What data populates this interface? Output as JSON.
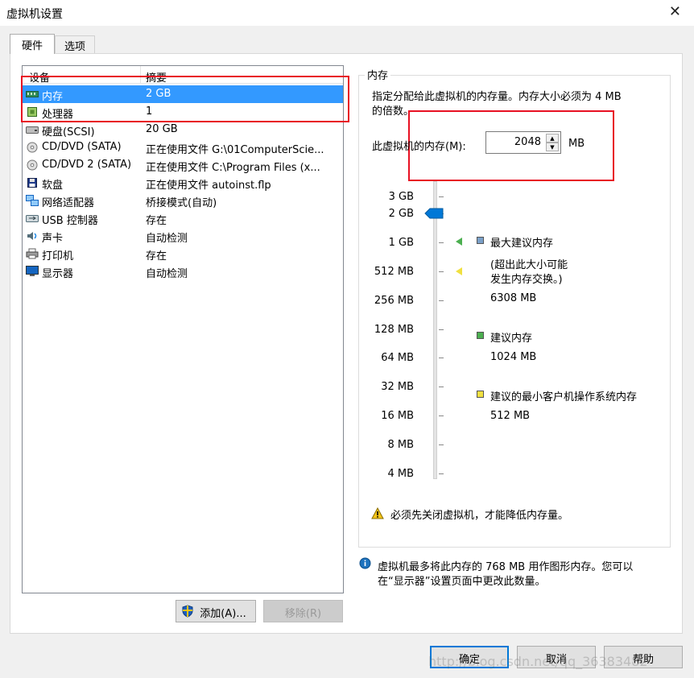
{
  "window": {
    "title": "虚拟机设置",
    "close_glyph": "✕"
  },
  "tabs": [
    {
      "label": "硬件"
    },
    {
      "label": "选项"
    }
  ],
  "device_list": {
    "headers": {
      "device": "设备",
      "summary": "摘要"
    },
    "rows": [
      {
        "name": "内存",
        "summary": "2 GB",
        "icon": "memory-icon",
        "selected": true
      },
      {
        "name": "处理器",
        "summary": "1",
        "icon": "cpu-icon"
      },
      {
        "name": "硬盘(SCSI)",
        "summary": "20 GB",
        "icon": "harddisk-icon"
      },
      {
        "name": "CD/DVD (SATA)",
        "summary": "正在使用文件 G:\\01ComputerScie...",
        "icon": "cd-icon"
      },
      {
        "name": "CD/DVD 2 (SATA)",
        "summary": "正在使用文件 C:\\Program Files (x...",
        "icon": "cd-icon"
      },
      {
        "name": "软盘",
        "summary": "正在使用文件 autoinst.flp",
        "icon": "floppy-icon"
      },
      {
        "name": "网络适配器",
        "summary": "桥接模式(自动)",
        "icon": "network-icon"
      },
      {
        "name": "USB 控制器",
        "summary": "存在",
        "icon": "usb-icon"
      },
      {
        "name": "声卡",
        "summary": "自动检测",
        "icon": "sound-icon"
      },
      {
        "name": "打印机",
        "summary": "存在",
        "icon": "printer-icon"
      },
      {
        "name": "显示器",
        "summary": "自动检测",
        "icon": "display-icon"
      }
    ]
  },
  "buttons": {
    "add": "添加(A)...",
    "remove": "移除(R)",
    "ok": "确定",
    "cancel": "取消",
    "help": "帮助"
  },
  "memory_panel": {
    "group_label": "内存",
    "description_line1": "指定分配给此虚拟机的内存量。内存大小必须为 4 MB",
    "description_line2": "的倍数。",
    "field_label": "此虚拟机的内存(M):",
    "value": "2048",
    "unit": "MB",
    "slider_level_mb": 2048,
    "scale_labels": [
      "3 GB",
      "2 GB",
      "1 GB",
      "512 MB",
      "256 MB",
      "128 MB",
      "64 MB",
      "32 MB",
      "16 MB",
      "8 MB",
      "4 MB"
    ],
    "legend": {
      "max_title": "最大建议内存",
      "max_note_line1": "(超出此大小可能",
      "max_note_line2": "发生内存交换。)",
      "max_value": "6308 MB",
      "rec_title": "建议内存",
      "rec_value": "1024 MB",
      "min_title": "建议的最小客户机操作系统内存",
      "min_value": "512 MB"
    },
    "warning": "必须先关闭虚拟机，才能降低内存量。",
    "info_line1": "虚拟机最多将此内存的 768 MB 用作图形内存。您可以",
    "info_line2": "在“显示器”设置页面中更改此数量。"
  },
  "colors": {
    "selection": "#3399ff",
    "annotation_red": "#e81123",
    "max_marker": "#7aa0c8",
    "rec_marker": "#4caf50",
    "min_marker": "#f0e040"
  },
  "watermark": "http://blog.csdn.net/qq_36383482"
}
